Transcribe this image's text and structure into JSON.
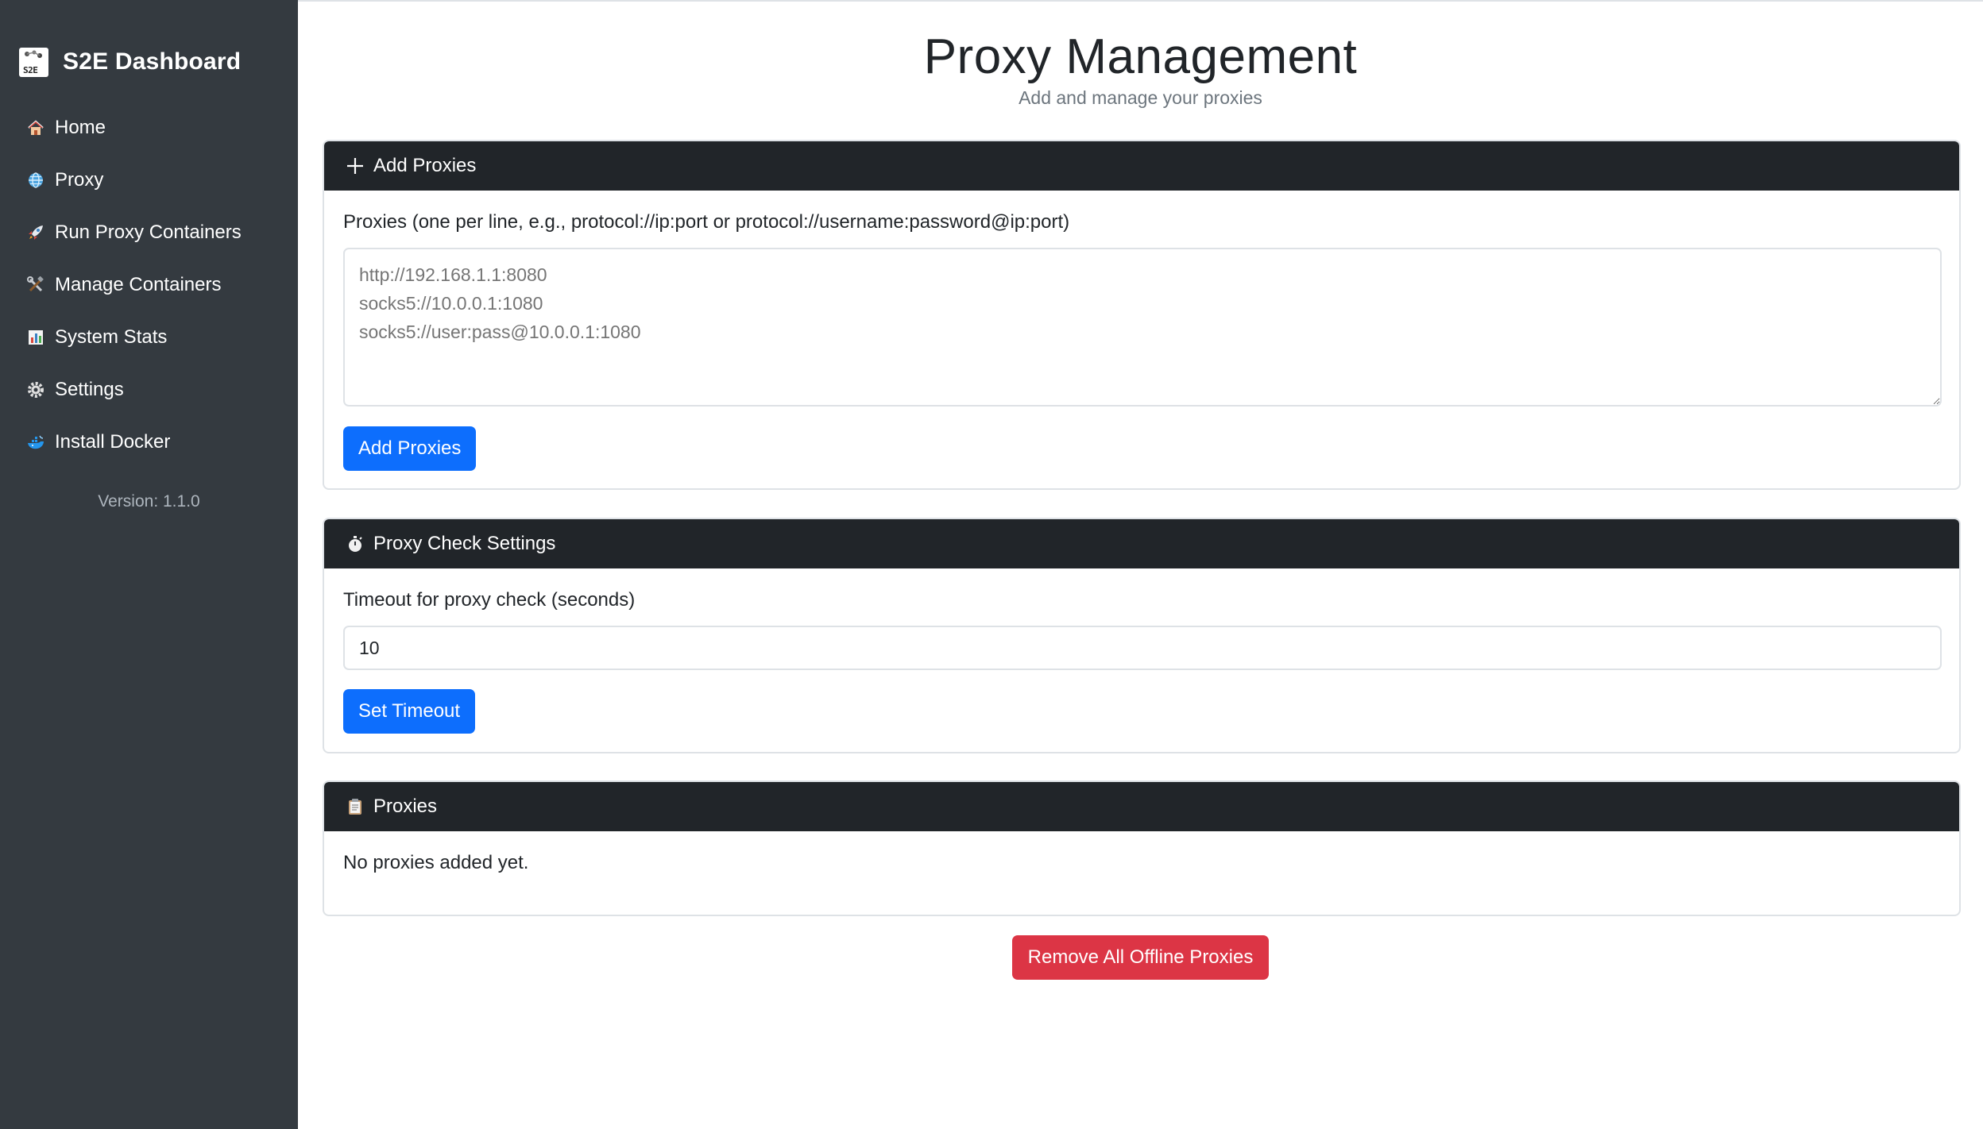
{
  "sidebar": {
    "brand": {
      "title": "S2E Dashboard",
      "logo_text": "S2E"
    },
    "items": [
      {
        "label": "Home",
        "icon": "house-icon"
      },
      {
        "label": "Proxy",
        "icon": "globe-icon"
      },
      {
        "label": "Run Proxy Containers",
        "icon": "rocket-icon"
      },
      {
        "label": "Manage Containers",
        "icon": "tools-icon"
      },
      {
        "label": "System Stats",
        "icon": "bar-chart-icon"
      },
      {
        "label": "Settings",
        "icon": "gear-icon"
      },
      {
        "label": "Install Docker",
        "icon": "whale-icon"
      }
    ],
    "version": "Version: 1.1.0"
  },
  "page": {
    "title": "Proxy Management",
    "subtitle": "Add and manage your proxies"
  },
  "add_proxies": {
    "header": "Add Proxies",
    "icon": "plus-icon",
    "label": "Proxies (one per line, e.g., protocol://ip:port or protocol://username:password@ip:port)",
    "placeholder": "http://192.168.1.1:8080\nsocks5://10.0.0.1:1080\nsocks5://user:pass@10.0.0.1:1080",
    "button": "Add Proxies"
  },
  "check_settings": {
    "header": "Proxy Check Settings",
    "icon": "stopwatch-icon",
    "label": "Timeout for proxy check (seconds)",
    "value": "10",
    "button": "Set Timeout"
  },
  "proxies": {
    "header": "Proxies",
    "icon": "clipboard-icon",
    "empty": "No proxies added yet."
  },
  "actions": {
    "remove_offline": "Remove All Offline Proxies"
  },
  "colors": {
    "sidebar_bg": "#343a40",
    "header_bg": "#212529",
    "primary": "#0d6efd",
    "danger": "#dc3545"
  }
}
